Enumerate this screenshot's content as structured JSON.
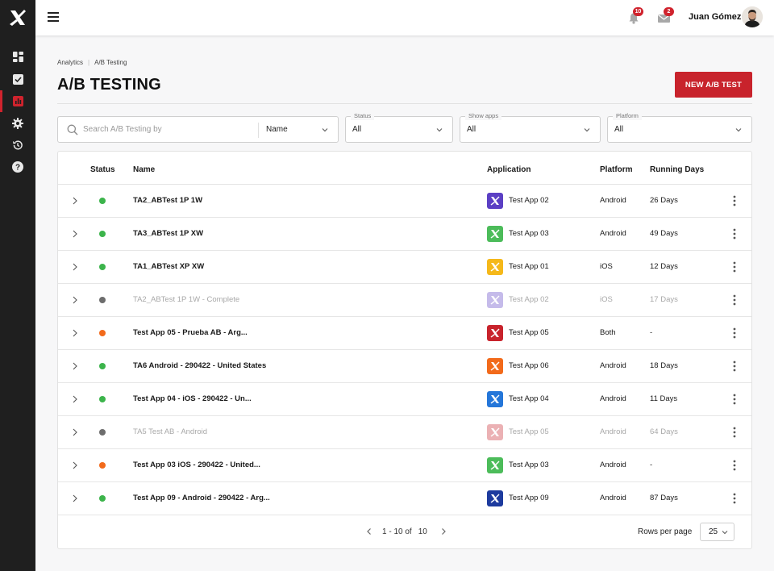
{
  "topbar": {
    "user_name": "Juan Gómez",
    "notifications_count": "10",
    "messages_count": "2"
  },
  "sidebar": {
    "items": [
      {
        "icon": "dashboard-icon"
      },
      {
        "icon": "checkbox-icon"
      },
      {
        "icon": "analytics-icon",
        "active": true
      },
      {
        "icon": "gear-icon"
      },
      {
        "icon": "history-icon"
      },
      {
        "icon": "help-icon"
      }
    ]
  },
  "breadcrumb": [
    "Analytics",
    "A/B Testing"
  ],
  "page_title": "A/B TESTING",
  "new_button_label": "NEW A/B TEST",
  "filters": {
    "search_placeholder": "Search A/B Testing by",
    "search_by": "Name",
    "status_label": "Status",
    "status_value": "All",
    "apps_label": "Show apps",
    "apps_value": "All",
    "platform_label": "Platform",
    "platform_value": "All"
  },
  "table": {
    "headers": {
      "status": "Status",
      "name": "Name",
      "application": "Application",
      "platform": "Platform",
      "days": "Running Days"
    },
    "rows": [
      {
        "status": "running",
        "name": "TA2_ABTest 1P 1W",
        "app": "Test App 02",
        "app_color": "#5b3fc4",
        "platform": "Android",
        "days": "26 Days",
        "muted": false
      },
      {
        "status": "running",
        "name": "TA3_ABTest 1P XW",
        "app": "Test App 03",
        "app_color": "#4cbc5a",
        "platform": "Android",
        "days": "49 Days",
        "muted": false
      },
      {
        "status": "running",
        "name": "TA1_ABTest XP XW",
        "app": "Test App 01",
        "app_color": "#f5b81a",
        "platform": "iOS",
        "days": "12 Days",
        "muted": false
      },
      {
        "status": "complete",
        "name": "TA2_ABTest 1P 1W - Complete",
        "app": "Test App 02",
        "app_color": "#5b3fc4",
        "platform": "iOS",
        "days": "17 Days",
        "muted": true
      },
      {
        "status": "paused",
        "name": "Test App 05 - Prueba AB - Arg...",
        "app": "Test App 05",
        "app_color": "#c8232c",
        "platform": "Both",
        "days": "-",
        "muted": false
      },
      {
        "status": "running",
        "name": "TA6 Android - 290422 - United States",
        "app": "Test App 06",
        "app_color": "#f26a1b",
        "platform": "Android",
        "days": "18 Days",
        "muted": false
      },
      {
        "status": "running",
        "name": "Test App 04 - iOS - 290422 - Un...",
        "app": "Test App 04",
        "app_color": "#2476d9",
        "platform": "Android",
        "days": "11 Days",
        "muted": false
      },
      {
        "status": "complete",
        "name": "TA5 Test AB - Android",
        "app": "Test App 05",
        "app_color": "#c8232c",
        "platform": "Android",
        "days": "64 Days",
        "muted": true
      },
      {
        "status": "paused",
        "name": "Test App 03 iOS - 290422 - United...",
        "app": "Test App 03",
        "app_color": "#4cbc5a",
        "platform": "Android",
        "days": "-",
        "muted": false
      },
      {
        "status": "running",
        "name": "Test App 09 - Android - 290422 - Arg...",
        "app": "Test App 09",
        "app_color": "#1d3b9e",
        "platform": "Android",
        "days": "87 Days",
        "muted": false
      }
    ]
  },
  "pagination": {
    "range": "1 - 10 of",
    "total": "10",
    "rows_per_page_label": "Rows per page",
    "rows_per_page": "25"
  },
  "colors": {
    "running": "#3cb44b",
    "paused": "#f26a1b",
    "complete": "#6d6d6d",
    "accent": "#c8232c"
  }
}
